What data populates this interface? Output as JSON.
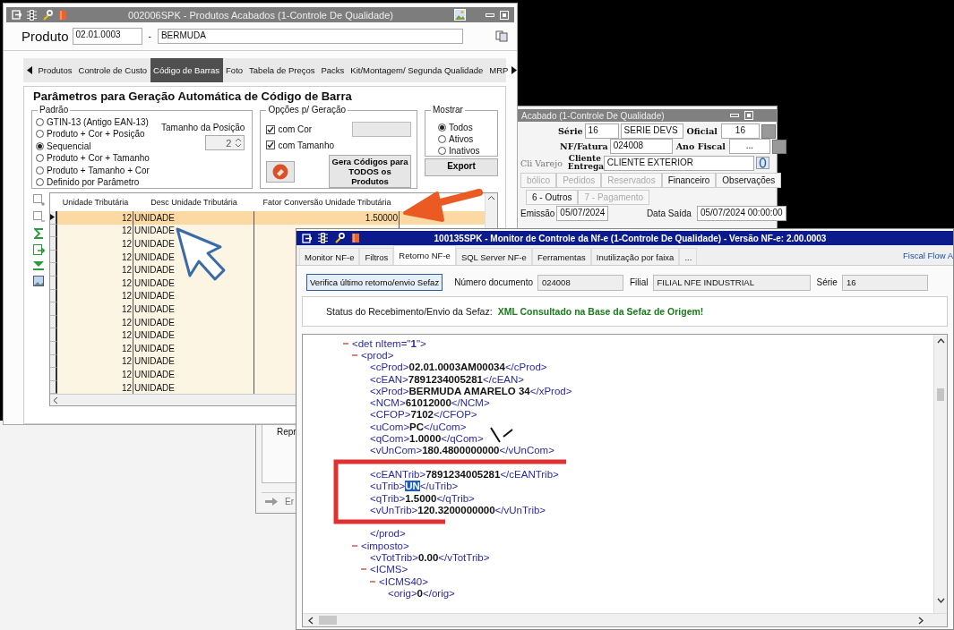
{
  "product_window": {
    "title": "002006SPK - Produtos Acabados (1-Controle De Qualidade)",
    "product_label": "Produto",
    "product_code": "02.01.0003",
    "separator": "-",
    "product_name": "BERMUDA",
    "tabs": [
      {
        "label": "Produtos",
        "selected": false
      },
      {
        "label": "Controle de Custo",
        "selected": false
      },
      {
        "label": "Código de Barras",
        "selected": true
      },
      {
        "label": "Foto",
        "selected": false
      },
      {
        "label": "Tabela de Preços",
        "selected": false
      },
      {
        "label": "Packs",
        "selected": false
      },
      {
        "label": "Kit/Montagem/ Segunda Qualidade",
        "selected": false
      },
      {
        "label": "MRP",
        "selected": false
      }
    ],
    "section_title": "Parâmetros para Geração Automática de Código de Barra",
    "standard_group": {
      "legend": "Padrão",
      "options": [
        {
          "label": "GTIN-13 (Antigo EAN-13)",
          "selected": false
        },
        {
          "label": "Produto + Cor + Posição",
          "selected": false
        },
        {
          "label": "Sequencial",
          "selected": true
        },
        {
          "label": "Produto + Cor + Tamanho",
          "selected": false
        },
        {
          "label": "Produto + Tamanho + Cor",
          "selected": false
        },
        {
          "label": "Definido por Parâmetro",
          "selected": false
        }
      ]
    },
    "position_size": {
      "label": "Tamanho da Posição",
      "value": "2"
    },
    "generation_group": {
      "legend": "Opções p/ Geração",
      "checks": [
        {
          "label": "com Cor",
          "checked": true
        },
        {
          "label": "com Tamanho",
          "checked": true
        }
      ],
      "generate_button": "Gera Códigos para TODOS os Produtos"
    },
    "show_group": {
      "legend": "Mostrar",
      "options": [
        {
          "label": "Todos",
          "selected": true
        },
        {
          "label": "Ativos",
          "selected": false
        },
        {
          "label": "Inativos",
          "selected": false
        }
      ]
    },
    "export_button": "Export",
    "grid": {
      "columns": [
        "Unidade Tributária",
        "Desc Unidade Tributária",
        "Fator Conversão Unidade Tributária"
      ],
      "rows": [
        {
          "unit": "12",
          "description": "UNIDADE",
          "factor": "1.50000",
          "selected": true
        },
        {
          "unit": "12",
          "description": "UNIDADE",
          "selected": false
        },
        {
          "unit": "12",
          "description": "UNIDADE",
          "selected": false
        },
        {
          "unit": "12",
          "description": "UNIDADE",
          "selected": false
        },
        {
          "unit": "12",
          "description": "UNIDADE",
          "selected": false
        },
        {
          "unit": "12",
          "description": "UNIDADE",
          "selected": false
        },
        {
          "unit": "12",
          "description": "UNIDADE",
          "selected": false
        },
        {
          "unit": "12",
          "description": "UNIDADE",
          "selected": false
        },
        {
          "unit": "12",
          "description": "UNIDADE",
          "selected": false
        },
        {
          "unit": "12",
          "description": "UNIDADE",
          "selected": false
        },
        {
          "unit": "12",
          "description": "UNIDADE",
          "selected": false
        },
        {
          "unit": "12",
          "description": "UNIDADE",
          "selected": false
        },
        {
          "unit": "12",
          "description": "UNIDADE",
          "selected": false
        },
        {
          "unit": "12",
          "description": "UNIDADE",
          "selected": false
        }
      ]
    }
  },
  "invoice_window": {
    "title": "Acabado (1-Controle De Qualidade)",
    "serie_label": "Série",
    "serie_code": "16",
    "serie_name": "SERIE DEVS",
    "official_label": "Oficial",
    "official_value": "16",
    "invoice_label": "NF/Fatura",
    "invoice_value": "024008",
    "fiscal_year_label": "Ano Fiscal",
    "fiscal_year_value": "...",
    "retail_label": "Cli Varejo",
    "delivery_label": "Cliente Entrega",
    "delivery_value": "CLIENTE EXTERIOR",
    "tabs": [
      {
        "label": "bólico",
        "disabled": true
      },
      {
        "label": "Pedidos",
        "disabled": true
      },
      {
        "label": "Reservados",
        "disabled": true
      },
      {
        "label": "Financeiro",
        "disabled": false
      },
      {
        "label": "Observações",
        "disabled": false
      }
    ],
    "subtabs": [
      {
        "label": "6 - Outros",
        "disabled": false
      },
      {
        "label": "7 - Pagamento",
        "disabled": true
      }
    ],
    "issue_label": "Emissão",
    "issue_value": "05/07/2024",
    "exit_label": "Data Saída",
    "exit_value": "05/07/2024 00:00:00",
    "notes_label": "Repr",
    "bottom_button": "Er"
  },
  "nfe_monitor_window": {
    "title": "100135SPK - Monitor de Controle da Nf-e (1-Controle De Qualidade) - Versão NF-e: 2.00.0003",
    "tabs": [
      {
        "label": "Monitor NF-e",
        "selected": false
      },
      {
        "label": "Filtros",
        "selected": false
      },
      {
        "label": "Retorno NF-e",
        "selected": true
      },
      {
        "label": "SQL Server NF-e",
        "selected": false
      },
      {
        "label": "Ferramentas",
        "selected": false
      },
      {
        "label": "Inutilização por faixa",
        "selected": false
      },
      {
        "label": "...",
        "selected": false
      }
    ],
    "side_link": "Fiscal Flow A",
    "check_button": "Verifica último retorno/envio Sefaz",
    "document_label": "Número documento",
    "document_value": "024008",
    "branch_label": "Filial",
    "branch_value": "FILIAL NFE INDUSTRIAL",
    "series_label": "Série",
    "series_value": "16",
    "status_label": "Status do Recebimento/Envio da Sefaz:",
    "status_message": "XML Consultado na Base da Sefaz de Origem!",
    "xml_tree": [
      {
        "kind": "element",
        "open": "<det nItem=\"**1**\">",
        "expanded": true,
        "children": [
          {
            "kind": "element",
            "open": "<prod>",
            "expanded": true,
            "close": "</prod>",
            "children": [
              {
                "kind": "leaf",
                "open": "<cProd>",
                "value": "02.01.0003AM00034",
                "close": "</cProd>",
                "selected": false
              },
              {
                "kind": "leaf",
                "open": "<cEAN>",
                "value": "7891234005281",
                "close": "</cEAN>",
                "selected": false
              },
              {
                "kind": "leaf",
                "open": "<xProd>",
                "value": "BERMUDA AMARELO 34",
                "close": "</xProd>",
                "selected": false
              },
              {
                "kind": "leaf",
                "open": "<NCM>",
                "value": "61012000",
                "close": "</NCM>",
                "selected": false
              },
              {
                "kind": "leaf",
                "open": "<CFOP>",
                "value": "7102",
                "close": "</CFOP>",
                "selected": false
              },
              {
                "kind": "leaf",
                "open": "<uCom>",
                "value": "PC",
                "close": "</uCom>",
                "selected": false
              },
              {
                "kind": "leaf",
                "open": "<qCom>",
                "value": "1.0000",
                "close": "</qCom>",
                "selected": false
              },
              {
                "kind": "leaf",
                "open": "<vUnCom>",
                "value": "180.4800000000",
                "close": "</vUnCom>",
                "selected": false
              },
              {
                "kind": "covered"
              },
              {
                "kind": "leaf",
                "open": "<cEANTrib>",
                "value": "7891234005281",
                "close": "</cEANTrib>",
                "selected": false
              },
              {
                "kind": "leaf",
                "open": "<uTrib>",
                "value": "UN",
                "close": "</uTrib>",
                "selected": true
              },
              {
                "kind": "leaf",
                "open": "<qTrib>",
                "value": "1.5000",
                "close": "</qTrib>",
                "selected": false
              },
              {
                "kind": "leaf",
                "open": "<vUnTrib>",
                "value": "120.3200000000",
                "close": "</vUnTrib>",
                "selected": false
              },
              {
                "kind": "covered"
              }
            ]
          },
          {
            "kind": "element",
            "open": "<imposto>",
            "expanded": true,
            "children": [
              {
                "kind": "leaf",
                "open": "<vTotTrib>",
                "value": "0.00",
                "close": "</vTotTrib>",
                "selected": false
              },
              {
                "kind": "element",
                "open": "<ICMS>",
                "expanded": true,
                "children": [
                  {
                    "kind": "element",
                    "open": "<ICMS40>",
                    "expanded": true,
                    "children": [
                      {
                        "kind": "leaf",
                        "open": "<orig>",
                        "value": "0",
                        "close": "</orig>",
                        "selected": false
                      }
                    ]
                  }
                ]
              }
            ]
          }
        ]
      }
    ]
  }
}
